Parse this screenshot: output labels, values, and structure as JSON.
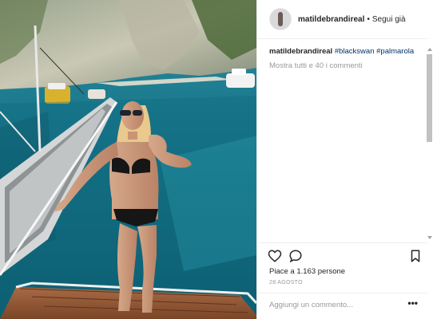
{
  "post": {
    "username": "matildebrandireal",
    "separator": "•",
    "follow_status": "Segui già",
    "caption_user": "matildebrandireal",
    "hashtags": [
      "#blackswan",
      "#palmarola"
    ],
    "show_all_comments": "Mostra tutti e 40 i commenti",
    "likes_text": "Piace a 1.163 persone",
    "date": "28 AGOSTO",
    "add_comment_placeholder": "Aggiungi un commento...",
    "more_options": "•••"
  },
  "colors": {
    "sea": "#1b7a8f",
    "text": "#262626",
    "muted": "#999999",
    "hashtag": "#003569",
    "border": "#efefef"
  },
  "icons": {
    "like": "heart-icon",
    "comment": "comment-bubble-icon",
    "save": "bookmark-icon",
    "options": "more-options-icon"
  }
}
